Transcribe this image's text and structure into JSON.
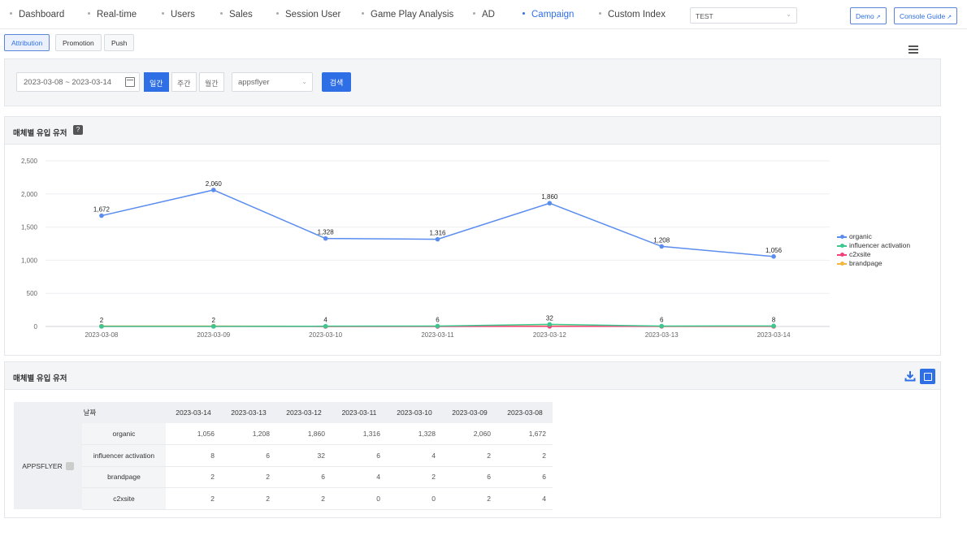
{
  "nav": {
    "items": [
      {
        "label": "Dashboard",
        "active": false
      },
      {
        "label": "Real-time",
        "active": false
      },
      {
        "label": "Users",
        "active": false
      },
      {
        "label": "Sales",
        "active": false
      },
      {
        "label": "Session User",
        "active": false
      },
      {
        "label": "Game Play Analysis",
        "active": false
      },
      {
        "label": "AD",
        "active": false
      },
      {
        "label": "Campaign",
        "active": true
      },
      {
        "label": "Custom Index",
        "active": false
      }
    ],
    "game_select": "TEST",
    "demo_label": "Demo",
    "console_label": "Console Guide"
  },
  "subtabs": [
    "Attribution",
    "Promotion",
    "Push"
  ],
  "filter": {
    "date_range": "2023-03-08 ~ 2023-03-14",
    "periods": [
      "일간",
      "주간",
      "월간"
    ],
    "source": "appsflyer",
    "search_label": "검색"
  },
  "chart_panel": {
    "title": "매체별 유입 유저"
  },
  "chart_data": {
    "type": "line",
    "categories": [
      "2023-03-08",
      "2023-03-09",
      "2023-03-10",
      "2023-03-11",
      "2023-03-12",
      "2023-03-13",
      "2023-03-14"
    ],
    "yticks": [
      "2,500",
      "2,000",
      "1,500",
      "1,000",
      "500",
      "0"
    ],
    "ylim": [
      0,
      2500
    ],
    "grid": true,
    "legend_placement": "right",
    "series": [
      {
        "name": "organic",
        "color": "#5b8def",
        "values": [
          1672,
          2060,
          1328,
          1316,
          1860,
          1208,
          1056
        ],
        "labels": [
          "1,672",
          "2,060",
          "1,328",
          "1,316",
          "1,860",
          "1,208",
          "1,056"
        ]
      },
      {
        "name": "influencer activation",
        "color": "#3cc78f",
        "values": [
          2,
          2,
          4,
          6,
          32,
          6,
          8
        ],
        "labels": [
          "2",
          "2",
          "4",
          "6",
          "32",
          "6",
          "8"
        ]
      },
      {
        "name": "c2xsite",
        "color": "#f0437a",
        "values": [
          2,
          2,
          0,
          0,
          2,
          2,
          2
        ]
      },
      {
        "name": "brandpage",
        "color": "#f2b740",
        "values": [
          6,
          6,
          2,
          4,
          6,
          2,
          2
        ]
      }
    ]
  },
  "table_panel": {
    "title": "매체별 유입 유저",
    "date_header": "날짜",
    "dates": [
      "2023-03-14",
      "2023-03-13",
      "2023-03-12",
      "2023-03-11",
      "2023-03-10",
      "2023-03-09",
      "2023-03-08"
    ],
    "group": "APPSFLYER",
    "rows": [
      {
        "metric": "organic",
        "values": [
          "1,056",
          "1,208",
          "1,860",
          "1,316",
          "1,328",
          "2,060",
          "1,672"
        ]
      },
      {
        "metric": "influencer activation",
        "values": [
          "8",
          "6",
          "32",
          "6",
          "4",
          "2",
          "2"
        ]
      },
      {
        "metric": "brandpage",
        "values": [
          "2",
          "2",
          "6",
          "4",
          "2",
          "6",
          "6"
        ]
      },
      {
        "metric": "c2xsite",
        "values": [
          "2",
          "2",
          "2",
          "0",
          "0",
          "2",
          "4"
        ]
      }
    ]
  }
}
